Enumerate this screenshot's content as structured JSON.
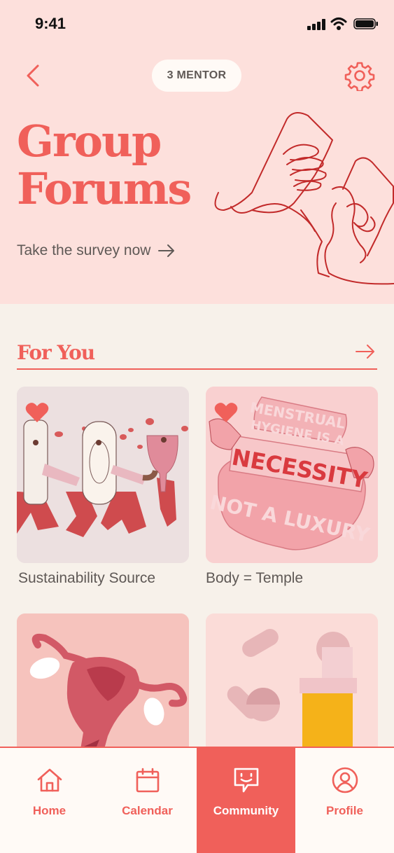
{
  "status_bar": {
    "time": "9:41"
  },
  "header": {
    "mentor_label": "3 MENTOR",
    "title_line1": "Group",
    "title_line2": "Forums",
    "survey_link": "Take the survey now"
  },
  "section": {
    "title": "For You"
  },
  "cards": [
    {
      "label": "Sustainability Source",
      "favorited": true
    },
    {
      "label": "Body = Temple",
      "favorited": true
    },
    {
      "label": ""
    },
    {
      "label": ""
    }
  ],
  "poster_text": {
    "line1": "MENSTRUAL",
    "line2": "HYGIENE IS A",
    "line3": "NECESSITY",
    "line4": "NOT A LUXURY"
  },
  "nav": {
    "items": [
      {
        "label": "Home",
        "icon": "home-icon"
      },
      {
        "label": "Calendar",
        "icon": "calendar-icon"
      },
      {
        "label": "Community",
        "icon": "chat-smile-icon",
        "active": true
      },
      {
        "label": "Profile",
        "icon": "profile-icon"
      }
    ]
  },
  "colors": {
    "accent": "#f0605a",
    "hero_bg": "#fde0dc",
    "page_bg": "#f7f1ea",
    "text": "#5f5956"
  }
}
